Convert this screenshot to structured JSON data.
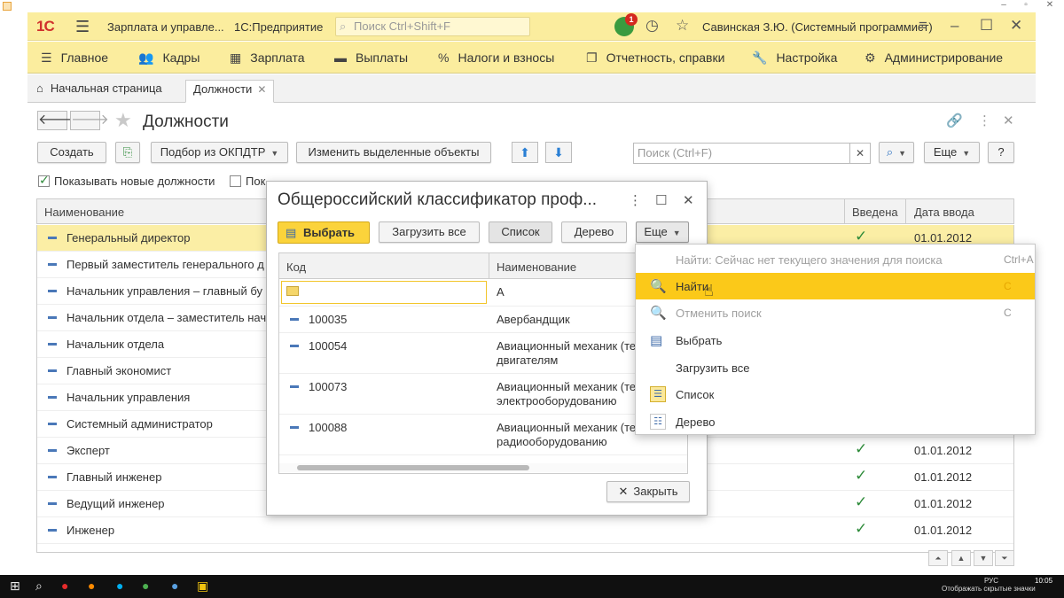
{
  "window": {
    "title_left": "Зарплата и управле...",
    "title_right": "1С:Предприятие",
    "search_placeholder": "Поиск Ctrl+Shift+F",
    "notifications": "1",
    "user": "Савинская З.Ю. (Системный программист)",
    "logo": "1С"
  },
  "sections": [
    {
      "icon": "hamburger-icon",
      "label": "Главное"
    },
    {
      "icon": "users-icon",
      "label": "Кадры"
    },
    {
      "icon": "calculator-icon",
      "label": "Зарплата"
    },
    {
      "icon": "wallet-icon",
      "label": "Выплаты"
    },
    {
      "icon": "percent-icon",
      "label": "Налоги и взносы"
    },
    {
      "icon": "reports-icon",
      "label": "Отчетность, справки"
    },
    {
      "icon": "wrench-icon",
      "label": "Настройка"
    },
    {
      "icon": "gear-icon",
      "label": "Администрирование"
    }
  ],
  "tabs": [
    {
      "label": "Начальная страница"
    },
    {
      "label": "Должности"
    }
  ],
  "form": {
    "title": "Должности",
    "create": "Создать",
    "okpdtr": "Подбор из ОКПДТР",
    "edit_selected": "Изменить выделенные объекты",
    "search_placeholder": "Поиск (Ctrl+F)",
    "more": "Еще",
    "help": "?",
    "chk_new": "Показывать новые должности",
    "chk_second": "Пок"
  },
  "grid": {
    "columns": [
      "Наименование",
      "Введена",
      "Дата ввода"
    ],
    "rows": [
      {
        "name": "Генеральный директор",
        "ok": "✓",
        "date": "01.01.2012"
      },
      {
        "name": "Первый заместитель генерального д",
        "ok": "",
        "date": ""
      },
      {
        "name": "Начальник управления – главный бу",
        "ok": "",
        "date": ""
      },
      {
        "name": "Начальник отдела – заместитель нач",
        "ok": "",
        "date": ""
      },
      {
        "name": "Начальник отдела",
        "ok": "",
        "date": ""
      },
      {
        "name": "Главный экономист",
        "ok": "",
        "date": ""
      },
      {
        "name": "Начальник управления",
        "ok": "",
        "date": ""
      },
      {
        "name": "Системный администратор",
        "ok": "",
        "date": ""
      },
      {
        "name": "Эксперт",
        "ok": "✓",
        "date": "01.01.2012"
      },
      {
        "name": "Главный инженер",
        "ok": "✓",
        "date": "01.01.2012"
      },
      {
        "name": "Ведущий инженер",
        "ok": "✓",
        "date": "01.01.2012"
      },
      {
        "name": "Инженер",
        "ok": "✓",
        "date": "01.01.2012"
      }
    ]
  },
  "dialog": {
    "title": "Общероссийский классификатор проф...",
    "select": "Выбрать",
    "load_all": "Загрузить все",
    "list": "Список",
    "tree": "Дерево",
    "more": "Еще",
    "close": "Закрыть",
    "columns": [
      "Код",
      "Наименование"
    ],
    "folder_row": {
      "code": "",
      "name": "А"
    },
    "rows": [
      {
        "code": "100035",
        "name1": "Авербандщик",
        "name2": ""
      },
      {
        "code": "100054",
        "name1": "Авиационный механик (те",
        "name2": "двигателям"
      },
      {
        "code": "100073",
        "name1": "Авиационный механик (те",
        "name2": "электрооборудованию"
      },
      {
        "code": "100088",
        "name1": "Авиационный механик (те",
        "name2": "радиооборудованию"
      }
    ]
  },
  "menu": {
    "items": [
      {
        "label": "Найти: Сейчас нет текущего значения для поиска",
        "shortcut": "Ctrl+A",
        "disabled": true
      },
      {
        "label": "Найти",
        "shortcut": "C",
        "highlighted": true
      },
      {
        "label": "Отменить поиск",
        "shortcut": "C",
        "disabled": true
      },
      {
        "label": "Выбрать",
        "shortcut": ""
      },
      {
        "label": "Загрузить все",
        "shortcut": ""
      },
      {
        "label": "Список",
        "shortcut": ""
      },
      {
        "label": "Дерево",
        "shortcut": ""
      }
    ]
  },
  "taskbar": {
    "tray_text": "Отображать скрытые значки",
    "lang": "РУС",
    "time": "10:05"
  }
}
